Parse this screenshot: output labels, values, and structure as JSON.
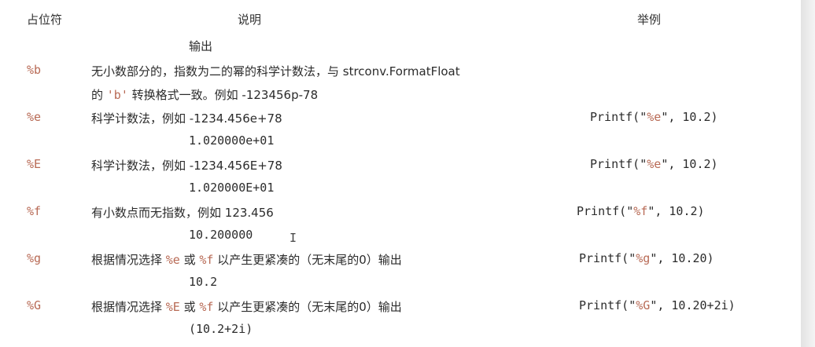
{
  "headers": {
    "placeholder": "占位符",
    "description": "说明",
    "example": "举例"
  },
  "top_fragment": "输出",
  "rows": [
    {
      "placeholder": "%b",
      "desc_line1": "无小数部分的，指数为二的幂的科学计数法，与 strconv.FormatFloat",
      "desc_line2_pre": "的 ",
      "desc_line2_code": "'b'",
      "desc_line2_post": " 转换格式一致。例如 -123456p-78",
      "example_pre": "",
      "example_fmt": "",
      "example_post": "",
      "result": ""
    },
    {
      "placeholder": "%e",
      "desc_line1": "科学计数法，例如 -1234.456e+78",
      "example_pre": "Printf(\"",
      "example_fmt": "%e",
      "example_post": "\", 10.2)",
      "result": "1.020000e+01"
    },
    {
      "placeholder": "%E",
      "desc_line1": "科学计数法，例如 -1234.456E+78",
      "example_pre": "Printf(\"",
      "example_fmt": "%e",
      "example_post": "\", 10.2)",
      "result": "1.020000E+01"
    },
    {
      "placeholder": "%f",
      "desc_line1": "有小数点而无指数，例如 123.456",
      "example_pre": "Printf(\"",
      "example_fmt": "%f",
      "example_post": "\", 10.2)",
      "result": "10.200000"
    },
    {
      "placeholder": "%g",
      "desc_line1_pre": "根据情况选择 ",
      "desc_line1_a": "%e",
      "desc_line1_mid": " 或 ",
      "desc_line1_b": "%f",
      "desc_line1_post": " 以产生更紧凑的（无末尾的0）输出",
      "example_pre": "Printf(\"",
      "example_fmt": "%g",
      "example_post": "\", 10.20)",
      "result": "10.2"
    },
    {
      "placeholder": "%G",
      "desc_line1_pre": "根据情况选择 ",
      "desc_line1_a": "%E",
      "desc_line1_mid": " 或 ",
      "desc_line1_b": "%f",
      "desc_line1_post": " 以产生更紧凑的（无末尾的0）输出",
      "example_pre": "Printf(\"",
      "example_fmt": "%G",
      "example_post": "\", 10.20+2i)",
      "result": "(10.2+2i)"
    }
  ],
  "colors": {
    "placeholder": "#b86a55",
    "text": "#2b2b2b",
    "background": "#ffffff"
  },
  "cursor_glyph": "I"
}
